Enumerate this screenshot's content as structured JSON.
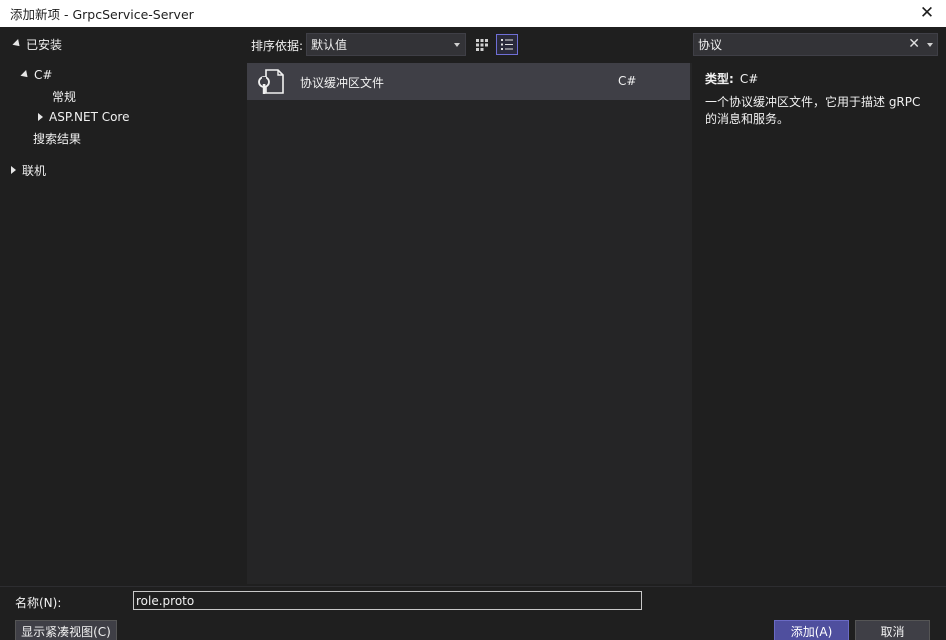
{
  "window": {
    "title": "添加新项 - GrpcService-Server",
    "close_glyph": "✕"
  },
  "tree": {
    "installed": "已安装",
    "csharp": "C#",
    "general": "常规",
    "aspnet": "ASP.NET Core",
    "search_results": "搜索结果",
    "online": "联机"
  },
  "toolbar": {
    "sort_label": "排序依据:",
    "sort_value": "默认值"
  },
  "search": {
    "value": "协议",
    "clear_glyph": "✕"
  },
  "templates": [
    {
      "name": "协议缓冲区文件",
      "language": "C#"
    }
  ],
  "detail": {
    "type_label": "类型:",
    "type_value": "C#",
    "description": "一个协议缓冲区文件，它用于描述 gRPC 的消息和服务。"
  },
  "bottom": {
    "name_label": "名称(N):",
    "name_value": "role.proto",
    "compact_view": "显示紧凑视图(C)",
    "add": "添加(A)",
    "cancel": "取消"
  },
  "colors": {
    "background": "#1f1f1f",
    "selected_row": "#3f3f46",
    "accent": "#4f4f9e"
  }
}
